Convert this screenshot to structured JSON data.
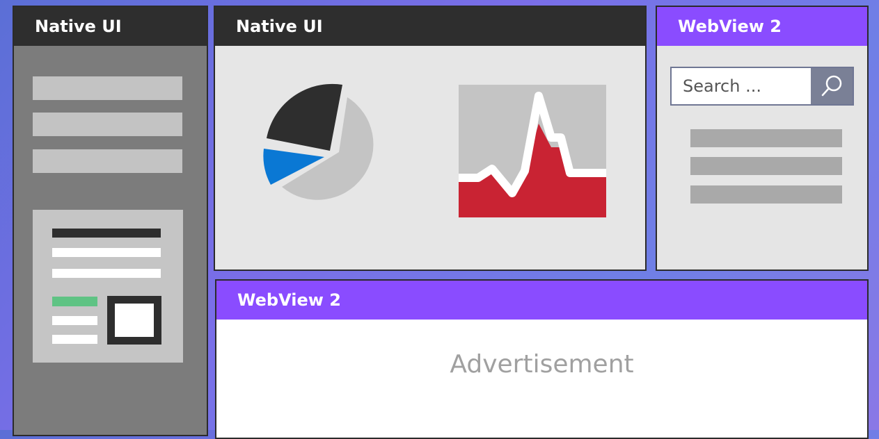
{
  "panels": {
    "left": {
      "header": "Native UI"
    },
    "center": {
      "header": "Native UI"
    },
    "right": {
      "header": "WebView 2",
      "search": {
        "placeholder": "Search ..."
      }
    },
    "bottom": {
      "header": "WebView 2",
      "content": "Advertisement"
    }
  },
  "colors": {
    "dark_header": "#2e2e2e",
    "webview_header": "#8a4cff",
    "pie_dark": "#2e2e2e",
    "pie_blue": "#0a78d4",
    "pie_light": "#c4c4c4",
    "area_red": "#c92333",
    "accent_green": "#5fc384"
  },
  "icons": {
    "search_button": "magnifier-icon"
  }
}
